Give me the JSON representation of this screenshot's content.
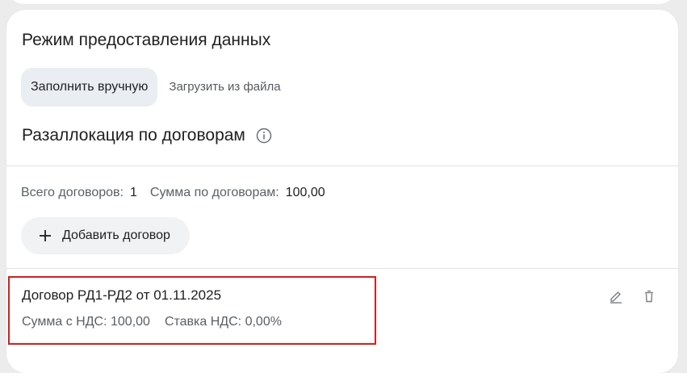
{
  "mode_section": {
    "title": "Режим предоставления данных",
    "tabs": [
      {
        "label": "Заполнить вручную",
        "active": true
      },
      {
        "label": "Загрузить из файла",
        "active": false
      }
    ]
  },
  "reallocation": {
    "title": "Разаллокация по договорам",
    "info_icon": "info-icon",
    "total_label": "Всего договоров:",
    "total_value": "1",
    "sum_label": "Сумма по договорам:",
    "sum_value": "100,00",
    "add_button_label": "Добавить договор"
  },
  "contracts": [
    {
      "title": "Договор РД1-РД2 от 01.11.2025",
      "amount_text": "Сумма с НДС: 100,00",
      "vat_text": "Ставка НДС: 0,00%"
    }
  ],
  "colors": {
    "highlight": "#d31f1f",
    "active_tab_bg": "#eaeef3",
    "button_bg": "#f1f2f4"
  }
}
